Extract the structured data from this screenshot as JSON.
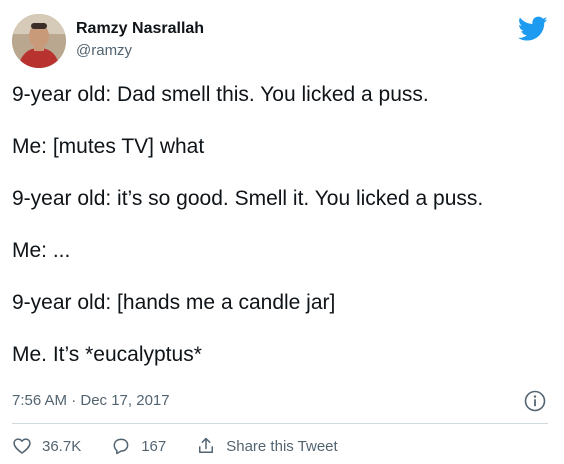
{
  "author": {
    "name": "Ramzy Nasrallah",
    "handle": "@ramzy"
  },
  "tweet": {
    "lines": [
      "9-year old: Dad smell this. You licked a puss.",
      "Me: [mutes TV] what",
      "9-year old: it’s so good. Smell it. You licked a puss.",
      "Me: ...",
      "9-year old: [hands me a candle jar]",
      "Me. It’s *eucalyptus*"
    ],
    "timestamp": "7:56 AM · Dec 17, 2017"
  },
  "actions": {
    "likes": "36.7K",
    "replies": "167",
    "share_label": "Share this Tweet"
  },
  "icons": {
    "brand": "twitter-bird-icon",
    "info": "info-icon",
    "like": "heart-icon",
    "reply": "reply-icon",
    "share": "share-icon"
  },
  "colors": {
    "brand_blue": "#1d9bf0",
    "text": "#0f1419",
    "muted": "#536471"
  }
}
